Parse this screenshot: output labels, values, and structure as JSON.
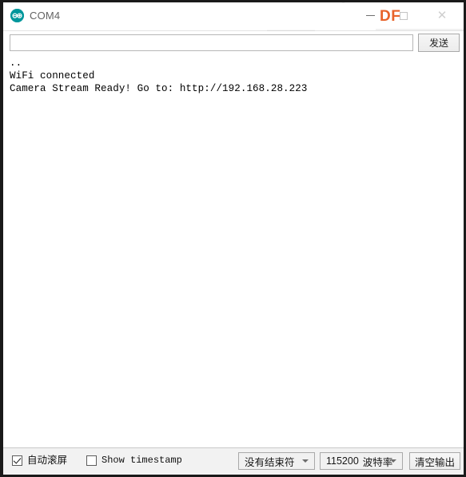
{
  "window": {
    "title": "COM4",
    "app_icon": "arduino-infinity-icon",
    "watermark": "DF",
    "watermark_color": "#E8632A",
    "controls": {
      "minimize": "minimize-icon",
      "maximize": "maximize-icon",
      "close": "close-icon"
    }
  },
  "send_row": {
    "input_value": "",
    "input_placeholder": "",
    "send_label": "发送"
  },
  "console": {
    "lines": [
      "..",
      "WiFi connected",
      "Camera Stream Ready! Go to: http://192.168.28.223"
    ]
  },
  "status_bar": {
    "autoscroll": {
      "label": "自动滚屏",
      "checked": true
    },
    "timestamp": {
      "label": "Show timestamp",
      "checked": false
    },
    "line_ending": {
      "selected": "没有结束符"
    },
    "baud_rate": {
      "selected_number": "115200",
      "selected_unit": "波特率"
    },
    "clear_label": "清空输出"
  }
}
